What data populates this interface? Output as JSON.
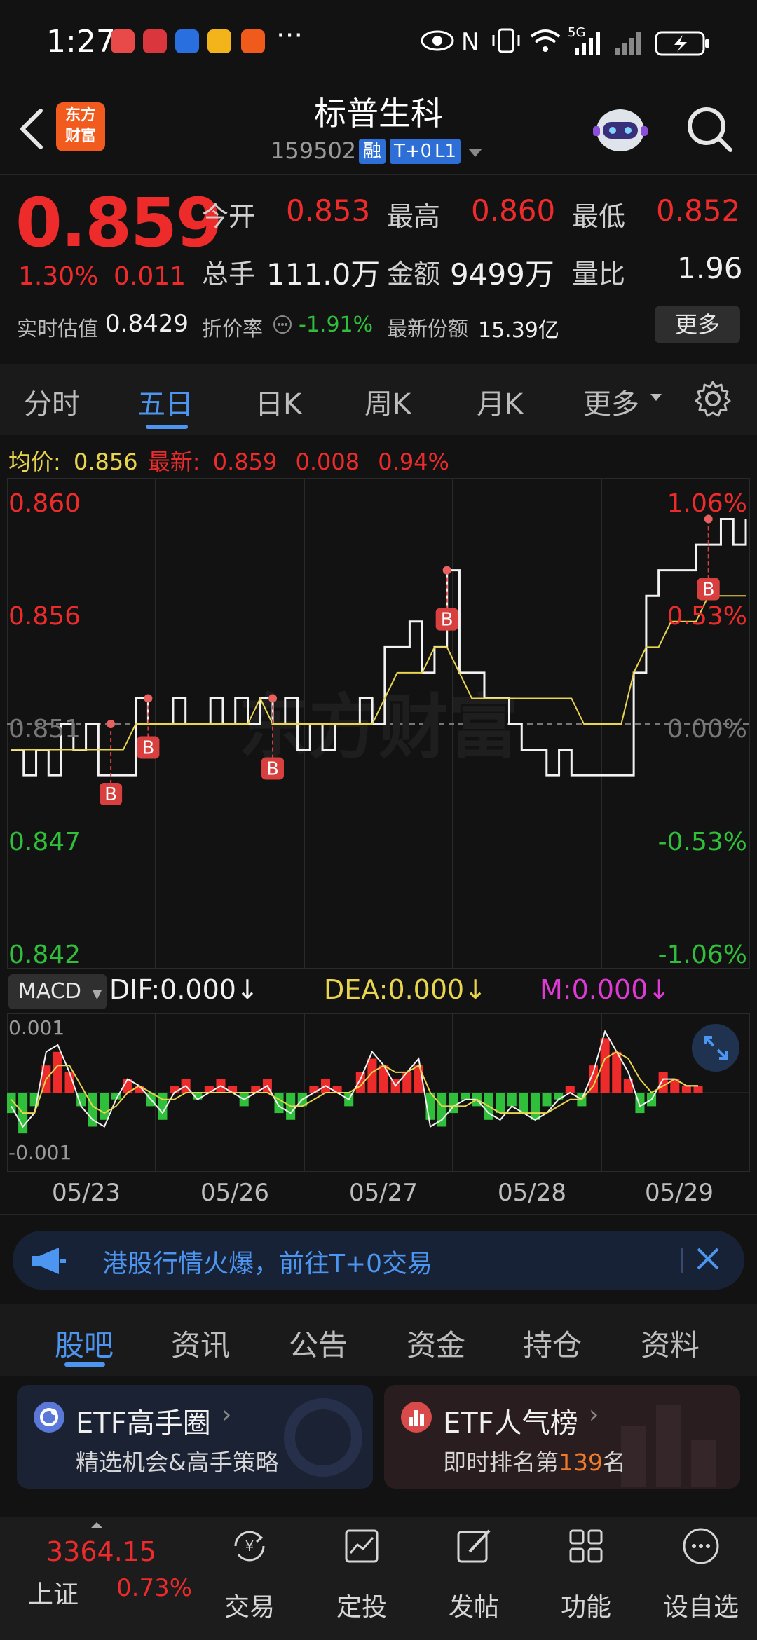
{
  "status_bar": {
    "time": "1:27",
    "dots": "···",
    "network": "5G"
  },
  "header": {
    "brand_line1": "东方",
    "brand_line2": "财富",
    "title": "标普生科",
    "code": "159502",
    "tags": [
      "融",
      "T+0",
      "L1"
    ]
  },
  "quote": {
    "price": "0.859",
    "change_pct": "1.30%",
    "change": "0.011",
    "open_label": "今开",
    "open": "0.853",
    "high_label": "最高",
    "high": "0.860",
    "low_label": "最低",
    "low": "0.852",
    "volume_label": "总手",
    "volume": "111.0万",
    "amount_label": "金额",
    "amount": "9499万",
    "vol_ratio_label": "量比",
    "vol_ratio": "1.96",
    "iopv_label": "实时估值",
    "iopv": "0.8429",
    "premium_label": "折价率",
    "premium": "-1.91%",
    "shares_label": "最新份额",
    "shares": "15.39亿",
    "more_button": "更多"
  },
  "period_tabs": [
    {
      "label": "分时",
      "active": false
    },
    {
      "label": "五日",
      "active": true
    },
    {
      "label": "日K",
      "active": false
    },
    {
      "label": "周K",
      "active": false
    },
    {
      "label": "月K",
      "active": false
    },
    {
      "label": "更多",
      "active": false
    }
  ],
  "info_line": {
    "avg_label": "均价:",
    "avg": "0.856",
    "latest_label": "最新:",
    "latest": "0.859",
    "latest_chg": "0.008",
    "latest_pct": "0.94%"
  },
  "chart_data": {
    "type": "line",
    "title": "",
    "x_labels": [
      "05/23",
      "05/26",
      "05/27",
      "05/28",
      "05/29"
    ],
    "y_ticks": [
      "0.860",
      "0.856",
      "0.851",
      "0.847",
      "0.842"
    ],
    "pct_ticks": [
      "1.06%",
      "0.53%",
      "0.00%",
      "-0.53%",
      "-1.06%"
    ],
    "ylim": [
      0.842,
      0.86
    ],
    "prev_close": 0.851,
    "series": [
      {
        "name": "最新",
        "values": [
          0.85,
          0.849,
          0.85,
          0.849,
          0.851,
          0.85,
          0.851,
          0.849,
          0.849,
          0.849,
          0.852,
          0.851,
          0.851,
          0.852,
          0.851,
          0.851,
          0.852,
          0.851,
          0.852,
          0.851,
          0.852,
          0.851,
          0.852,
          0.85,
          0.851,
          0.85,
          0.851,
          0.851,
          0.852,
          0.851,
          0.854,
          0.854,
          0.855,
          0.853,
          0.854,
          0.857,
          0.853,
          0.853,
          0.852,
          0.852,
          0.851,
          0.85,
          0.85,
          0.849,
          0.85,
          0.849,
          0.849,
          0.849,
          0.849,
          0.849,
          0.853,
          0.856,
          0.857,
          0.857,
          0.857,
          0.858,
          0.858,
          0.859,
          0.858,
          0.859
        ]
      },
      {
        "name": "均价",
        "values": [
          0.85,
          0.85,
          0.85,
          0.85,
          0.85,
          0.85,
          0.85,
          0.85,
          0.85,
          0.85,
          0.851,
          0.851,
          0.851,
          0.851,
          0.851,
          0.851,
          0.851,
          0.851,
          0.851,
          0.851,
          0.852,
          0.851,
          0.851,
          0.851,
          0.851,
          0.851,
          0.851,
          0.851,
          0.851,
          0.851,
          0.852,
          0.853,
          0.853,
          0.853,
          0.854,
          0.854,
          0.853,
          0.852,
          0.852,
          0.852,
          0.852,
          0.852,
          0.852,
          0.852,
          0.852,
          0.852,
          0.851,
          0.851,
          0.851,
          0.851,
          0.853,
          0.854,
          0.854,
          0.855,
          0.855,
          0.855,
          0.856,
          0.856,
          0.856,
          0.856
        ]
      }
    ],
    "buy_markers": [
      {
        "index": 8,
        "price": 0.851,
        "label": "B"
      },
      {
        "index": 11,
        "price": 0.852,
        "label": "B"
      },
      {
        "index": 21,
        "price": 0.852,
        "label": "B"
      },
      {
        "index": 35,
        "price": 0.857,
        "label": "B"
      },
      {
        "index": 56,
        "price": 0.859,
        "label": "B"
      }
    ],
    "grid": true
  },
  "macd": {
    "selector": "MACD",
    "dif": "DIF:0.000",
    "dea": "DEA:0.000",
    "m": "M:0.000",
    "arrow": "↓",
    "ytop": "0.001",
    "ybottom": "-0.001",
    "ylim": [
      -0.001,
      0.001
    ],
    "histogram": [
      -0.0003,
      -0.0006,
      -0.0002,
      0.0004,
      0.0006,
      0.0003,
      -0.0002,
      -0.0005,
      -0.0004,
      -0.0001,
      0.0002,
      0.0001,
      -0.0002,
      -0.0004,
      0.0001,
      0.0002,
      -0.0001,
      0.0001,
      0.0002,
      0.0001,
      -0.0002,
      0.0001,
      0.0002,
      -0.0003,
      -0.0004,
      -0.0002,
      0.0001,
      0.0002,
      0.0001,
      -0.0002,
      0.0003,
      0.0005,
      0.0004,
      0.0002,
      0.0003,
      0.0004,
      -0.0004,
      -0.0005,
      -0.0003,
      -0.0001,
      -0.0002,
      -0.0004,
      -0.0003,
      -0.0002,
      -0.0003,
      -0.0004,
      -0.0002,
      -0.0001,
      0.0001,
      -0.0002,
      0.0004,
      0.0008,
      0.0006,
      0.0002,
      -0.0003,
      -0.0002,
      0.0003,
      0.0002,
      0.0001,
      0.0001
    ],
    "dif_values": [
      -0.0002,
      -0.0005,
      -0.0003,
      0.0006,
      0.0007,
      0.0003,
      -0.0002,
      -0.0004,
      -0.0005,
      -0.0001,
      0.0002,
      0.0001,
      -0.0001,
      -0.0003,
      0.0,
      0.0001,
      -0.0001,
      0.0,
      0.0001,
      0.0,
      -0.0001,
      0.0,
      0.0001,
      -0.0002,
      -0.0003,
      -0.0001,
      0.0,
      0.0001,
      0.0,
      -0.0001,
      0.0002,
      0.0006,
      0.0004,
      0.0001,
      0.0003,
      0.0005,
      -0.0005,
      -0.0004,
      -0.0002,
      -0.0001,
      -0.0001,
      -0.0003,
      -0.0004,
      -0.0002,
      -0.0003,
      -0.0004,
      -0.0003,
      -0.0001,
      0.0,
      -0.0001,
      0.0003,
      0.0009,
      0.0006,
      0.0003,
      -0.0002,
      -0.0001,
      0.0002,
      0.0002,
      0.0001,
      0.0001
    ],
    "dea_values": [
      -0.0001,
      -0.0003,
      -0.0003,
      0.0002,
      0.0004,
      0.0004,
      0.0001,
      -0.0002,
      -0.0003,
      -0.0002,
      0.0,
      0.0001,
      0.0,
      -0.0001,
      -0.0001,
      0.0,
      0.0,
      0.0,
      0.0,
      0.0,
      0.0,
      0.0,
      0.0,
      -0.0001,
      -0.0002,
      -0.0002,
      -0.0001,
      0.0,
      0.0,
      0.0,
      0.0001,
      0.0003,
      0.0004,
      0.0003,
      0.0003,
      0.0004,
      0.0,
      -0.0002,
      -0.0002,
      -0.0002,
      -0.0001,
      -0.0002,
      -0.0003,
      -0.0003,
      -0.0003,
      -0.0003,
      -0.0003,
      -0.0002,
      -0.0001,
      -0.0001,
      0.0001,
      0.0005,
      0.0006,
      0.0005,
      0.0002,
      0.0,
      0.0001,
      0.0002,
      0.0001,
      0.0001
    ]
  },
  "banner": {
    "text": "港股行情火爆，前往T+0交易"
  },
  "section_tabs": [
    {
      "label": "股吧",
      "active": true
    },
    {
      "label": "资讯",
      "active": false
    },
    {
      "label": "公告",
      "active": false
    },
    {
      "label": "资金",
      "active": false
    },
    {
      "label": "持仓",
      "active": false
    },
    {
      "label": "资料",
      "active": false
    }
  ],
  "cards": {
    "left": {
      "title": "ETF高手圈",
      "subtitle": "精选机会&高手策略"
    },
    "right": {
      "title": "ETF人气榜",
      "subtitle_prefix": "即时排名第",
      "rank": "139",
      "subtitle_suffix": "名"
    }
  },
  "bottom_nav": {
    "index_value": "3364.15",
    "index_name": "上证",
    "index_pct": "0.73%",
    "items": [
      {
        "label": "交易",
        "icon": "yuan-exchange-icon"
      },
      {
        "label": "定投",
        "icon": "chart-calendar-icon"
      },
      {
        "label": "发帖",
        "icon": "edit-post-icon"
      },
      {
        "label": "功能",
        "icon": "grid-apps-icon"
      },
      {
        "label": "设自选",
        "icon": "more-dots-icon"
      }
    ]
  },
  "colors": {
    "up": "#ee2b2b",
    "down": "#2fbf3a",
    "accent": "#4c95f0",
    "avg_line": "#e8d44d",
    "magenta": "#e03ad6"
  }
}
